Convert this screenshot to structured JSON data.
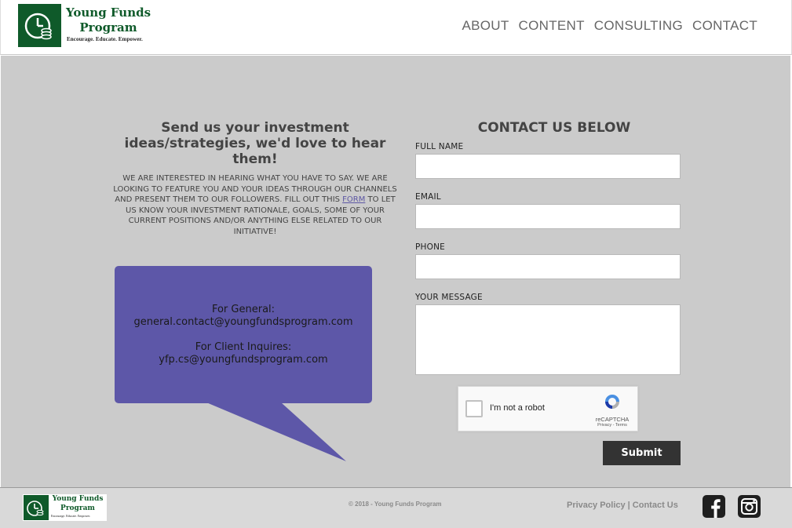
{
  "header": {
    "logo_title_line1": "Young Funds",
    "logo_title_line2": "Program",
    "logo_tagline": "Encourage. Educate. Empower.",
    "nav": [
      "ABOUT",
      "CONTENT",
      "CONSULTING",
      "CONTACT"
    ]
  },
  "left": {
    "title": "Send us your investment ideas/strategies, we'd love to hear them!",
    "body_before_link": "We are interested in hearing what you have to say. We are looking to feature you and your ideas through our channels and present them to our followers. Fill out this ",
    "link_text": "form",
    "body_after_link": " to let us know your investment rationale, goals, some of your current positions and/or anything else related to our initiative!"
  },
  "bubble": {
    "general_label": "For General:",
    "general_email": "general.contact@youngfundsprogram.com",
    "client_label": "For Client Inquires:",
    "client_email": "yfp.cs@youngfundsprogram.com",
    "color": "#5d57a8"
  },
  "form": {
    "title": "CONTACT US BELOW",
    "fields": [
      {
        "label": "FULL NAME",
        "value": ""
      },
      {
        "label": "EMAIL",
        "value": ""
      },
      {
        "label": "PHONE",
        "value": ""
      },
      {
        "label": "YOUR MESSAGE",
        "value": ""
      }
    ],
    "captcha_text": "I'm not a robot",
    "captcha_brand": "reCAPTCHA",
    "captcha_links": "Privacy - Terms",
    "submit_label": "Submit"
  },
  "footer": {
    "logo_title_line1": "Young Funds",
    "logo_title_line2": "Program",
    "copyright": "© 2018 - Young Funds Program",
    "links": "Privacy Policy | Contact Us",
    "social": [
      "facebook-icon",
      "instagram-icon"
    ]
  },
  "colors": {
    "brand_green": "#0f5a2a",
    "main_bg": "#cbcbcb",
    "submit_bg": "#333333"
  }
}
